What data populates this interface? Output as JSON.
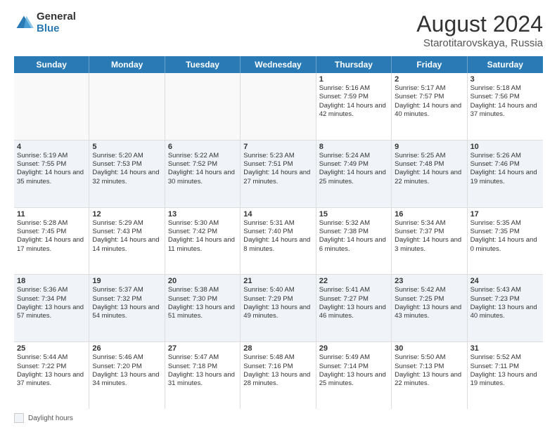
{
  "header": {
    "logo_general": "General",
    "logo_blue": "Blue",
    "month_year": "August 2024",
    "location": "Starotitarovskaya, Russia"
  },
  "weekdays": [
    "Sunday",
    "Monday",
    "Tuesday",
    "Wednesday",
    "Thursday",
    "Friday",
    "Saturday"
  ],
  "footer": {
    "label": "Daylight hours"
  },
  "rows": [
    {
      "cells": [
        {
          "empty": true
        },
        {
          "empty": true
        },
        {
          "empty": true
        },
        {
          "empty": true
        },
        {
          "day": 1,
          "sunrise": "5:16 AM",
          "sunset": "7:59 PM",
          "daylight": "14 hours and 42 minutes."
        },
        {
          "day": 2,
          "sunrise": "5:17 AM",
          "sunset": "7:57 PM",
          "daylight": "14 hours and 40 minutes."
        },
        {
          "day": 3,
          "sunrise": "5:18 AM",
          "sunset": "7:56 PM",
          "daylight": "14 hours and 37 minutes."
        }
      ]
    },
    {
      "cells": [
        {
          "day": 4,
          "sunrise": "5:19 AM",
          "sunset": "7:55 PM",
          "daylight": "14 hours and 35 minutes."
        },
        {
          "day": 5,
          "sunrise": "5:20 AM",
          "sunset": "7:53 PM",
          "daylight": "14 hours and 32 minutes."
        },
        {
          "day": 6,
          "sunrise": "5:22 AM",
          "sunset": "7:52 PM",
          "daylight": "14 hours and 30 minutes."
        },
        {
          "day": 7,
          "sunrise": "5:23 AM",
          "sunset": "7:51 PM",
          "daylight": "14 hours and 27 minutes."
        },
        {
          "day": 8,
          "sunrise": "5:24 AM",
          "sunset": "7:49 PM",
          "daylight": "14 hours and 25 minutes."
        },
        {
          "day": 9,
          "sunrise": "5:25 AM",
          "sunset": "7:48 PM",
          "daylight": "14 hours and 22 minutes."
        },
        {
          "day": 10,
          "sunrise": "5:26 AM",
          "sunset": "7:46 PM",
          "daylight": "14 hours and 19 minutes."
        }
      ]
    },
    {
      "cells": [
        {
          "day": 11,
          "sunrise": "5:28 AM",
          "sunset": "7:45 PM",
          "daylight": "14 hours and 17 minutes."
        },
        {
          "day": 12,
          "sunrise": "5:29 AM",
          "sunset": "7:43 PM",
          "daylight": "14 hours and 14 minutes."
        },
        {
          "day": 13,
          "sunrise": "5:30 AM",
          "sunset": "7:42 PM",
          "daylight": "14 hours and 11 minutes."
        },
        {
          "day": 14,
          "sunrise": "5:31 AM",
          "sunset": "7:40 PM",
          "daylight": "14 hours and 8 minutes."
        },
        {
          "day": 15,
          "sunrise": "5:32 AM",
          "sunset": "7:38 PM",
          "daylight": "14 hours and 6 minutes."
        },
        {
          "day": 16,
          "sunrise": "5:34 AM",
          "sunset": "7:37 PM",
          "daylight": "14 hours and 3 minutes."
        },
        {
          "day": 17,
          "sunrise": "5:35 AM",
          "sunset": "7:35 PM",
          "daylight": "14 hours and 0 minutes."
        }
      ]
    },
    {
      "cells": [
        {
          "day": 18,
          "sunrise": "5:36 AM",
          "sunset": "7:34 PM",
          "daylight": "13 hours and 57 minutes."
        },
        {
          "day": 19,
          "sunrise": "5:37 AM",
          "sunset": "7:32 PM",
          "daylight": "13 hours and 54 minutes."
        },
        {
          "day": 20,
          "sunrise": "5:38 AM",
          "sunset": "7:30 PM",
          "daylight": "13 hours and 51 minutes."
        },
        {
          "day": 21,
          "sunrise": "5:40 AM",
          "sunset": "7:29 PM",
          "daylight": "13 hours and 49 minutes."
        },
        {
          "day": 22,
          "sunrise": "5:41 AM",
          "sunset": "7:27 PM",
          "daylight": "13 hours and 46 minutes."
        },
        {
          "day": 23,
          "sunrise": "5:42 AM",
          "sunset": "7:25 PM",
          "daylight": "13 hours and 43 minutes."
        },
        {
          "day": 24,
          "sunrise": "5:43 AM",
          "sunset": "7:23 PM",
          "daylight": "13 hours and 40 minutes."
        }
      ]
    },
    {
      "cells": [
        {
          "day": 25,
          "sunrise": "5:44 AM",
          "sunset": "7:22 PM",
          "daylight": "13 hours and 37 minutes."
        },
        {
          "day": 26,
          "sunrise": "5:46 AM",
          "sunset": "7:20 PM",
          "daylight": "13 hours and 34 minutes."
        },
        {
          "day": 27,
          "sunrise": "5:47 AM",
          "sunset": "7:18 PM",
          "daylight": "13 hours and 31 minutes."
        },
        {
          "day": 28,
          "sunrise": "5:48 AM",
          "sunset": "7:16 PM",
          "daylight": "13 hours and 28 minutes."
        },
        {
          "day": 29,
          "sunrise": "5:49 AM",
          "sunset": "7:14 PM",
          "daylight": "13 hours and 25 minutes."
        },
        {
          "day": 30,
          "sunrise": "5:50 AM",
          "sunset": "7:13 PM",
          "daylight": "13 hours and 22 minutes."
        },
        {
          "day": 31,
          "sunrise": "5:52 AM",
          "sunset": "7:11 PM",
          "daylight": "13 hours and 19 minutes."
        }
      ]
    }
  ]
}
